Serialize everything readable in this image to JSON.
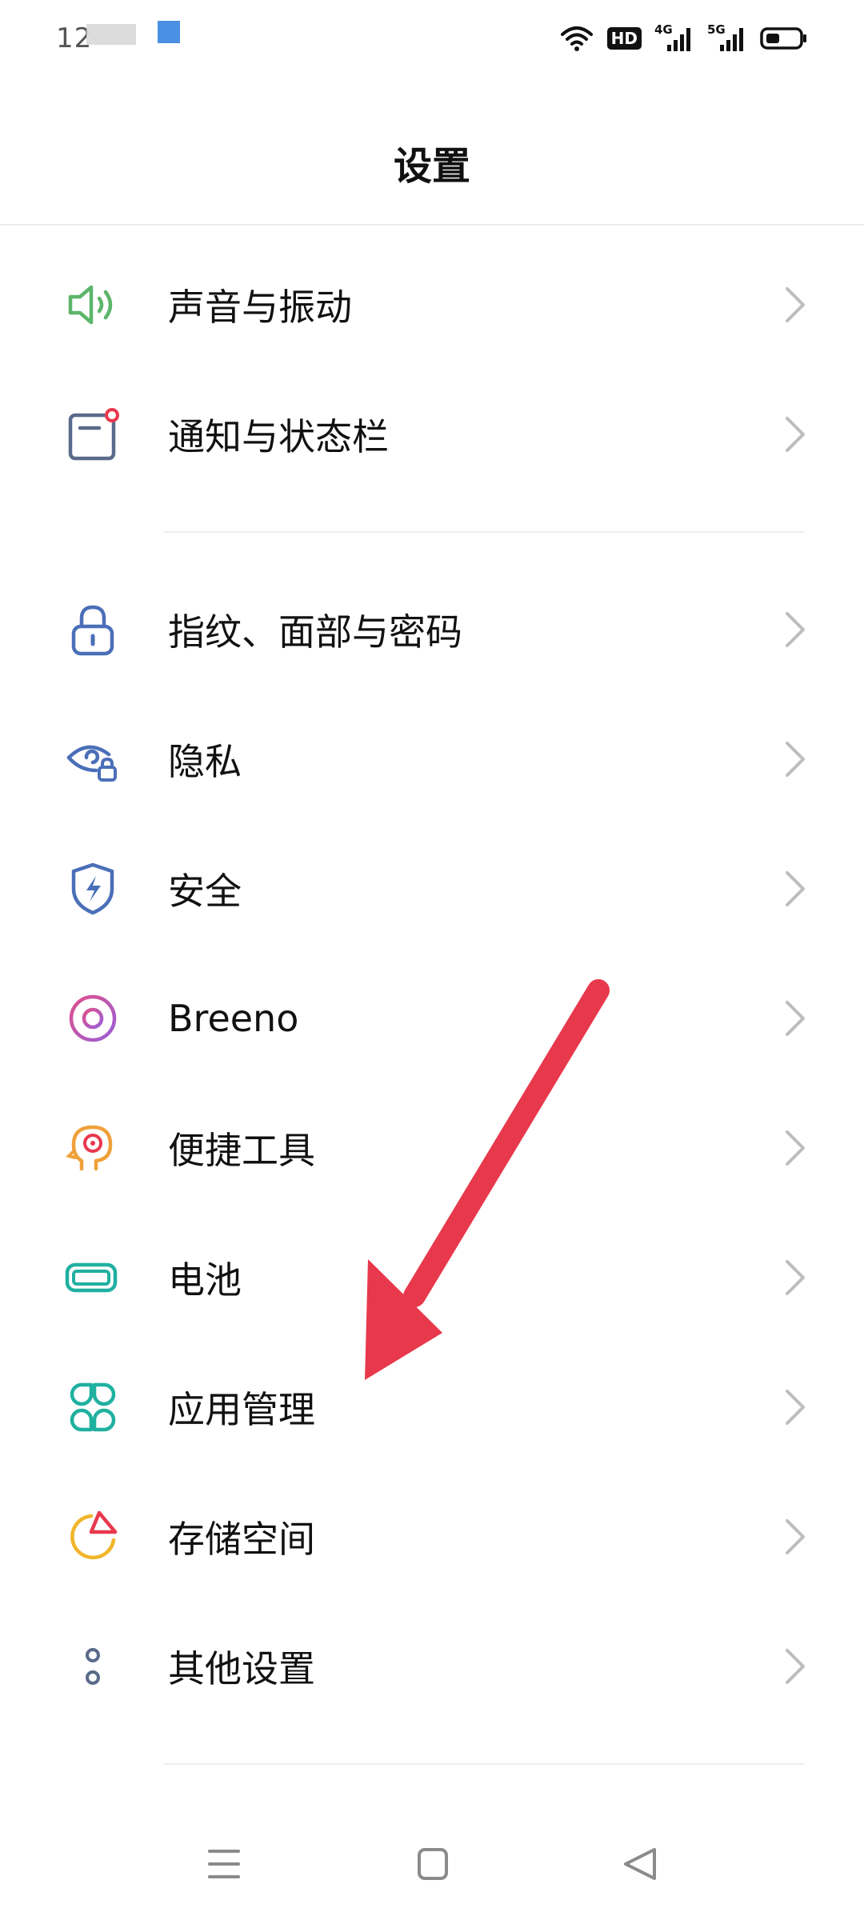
{
  "status_bar": {
    "time": "12",
    "icons": [
      "wifi-icon",
      "hd-icon",
      "4g-signal-icon",
      "5g-signal-icon",
      "battery-icon"
    ],
    "hd_label": "HD",
    "g4_label": "4G",
    "g5_label": "5G"
  },
  "header": {
    "title": "设置"
  },
  "settings": {
    "items": [
      {
        "label": "声音与振动",
        "icon": "speaker-icon"
      },
      {
        "label": "通知与状态栏",
        "icon": "notification-icon"
      },
      {
        "label": "指纹、面部与密码",
        "icon": "lock-icon"
      },
      {
        "label": "隐私",
        "icon": "privacy-eye-icon"
      },
      {
        "label": "安全",
        "icon": "shield-icon"
      },
      {
        "label": "Breeno",
        "icon": "breeno-icon"
      },
      {
        "label": "便捷工具",
        "icon": "tools-head-icon"
      },
      {
        "label": "电池",
        "icon": "battery-icon"
      },
      {
        "label": "应用管理",
        "icon": "apps-icon"
      },
      {
        "label": "存储空间",
        "icon": "storage-pie-icon"
      },
      {
        "label": "其他设置",
        "icon": "more-dots-icon"
      }
    ]
  },
  "colors": {
    "accent_red_arrow": "#e8384c",
    "green": "#5cb56a",
    "blue": "#4a6fb8",
    "slate": "#5a6a8a",
    "teal": "#1fb0a0",
    "orange": "#f0a03a",
    "purple": "#b05bd0"
  },
  "nav_bar": {
    "icons": [
      "menu-icon",
      "home-icon",
      "back-icon"
    ]
  }
}
